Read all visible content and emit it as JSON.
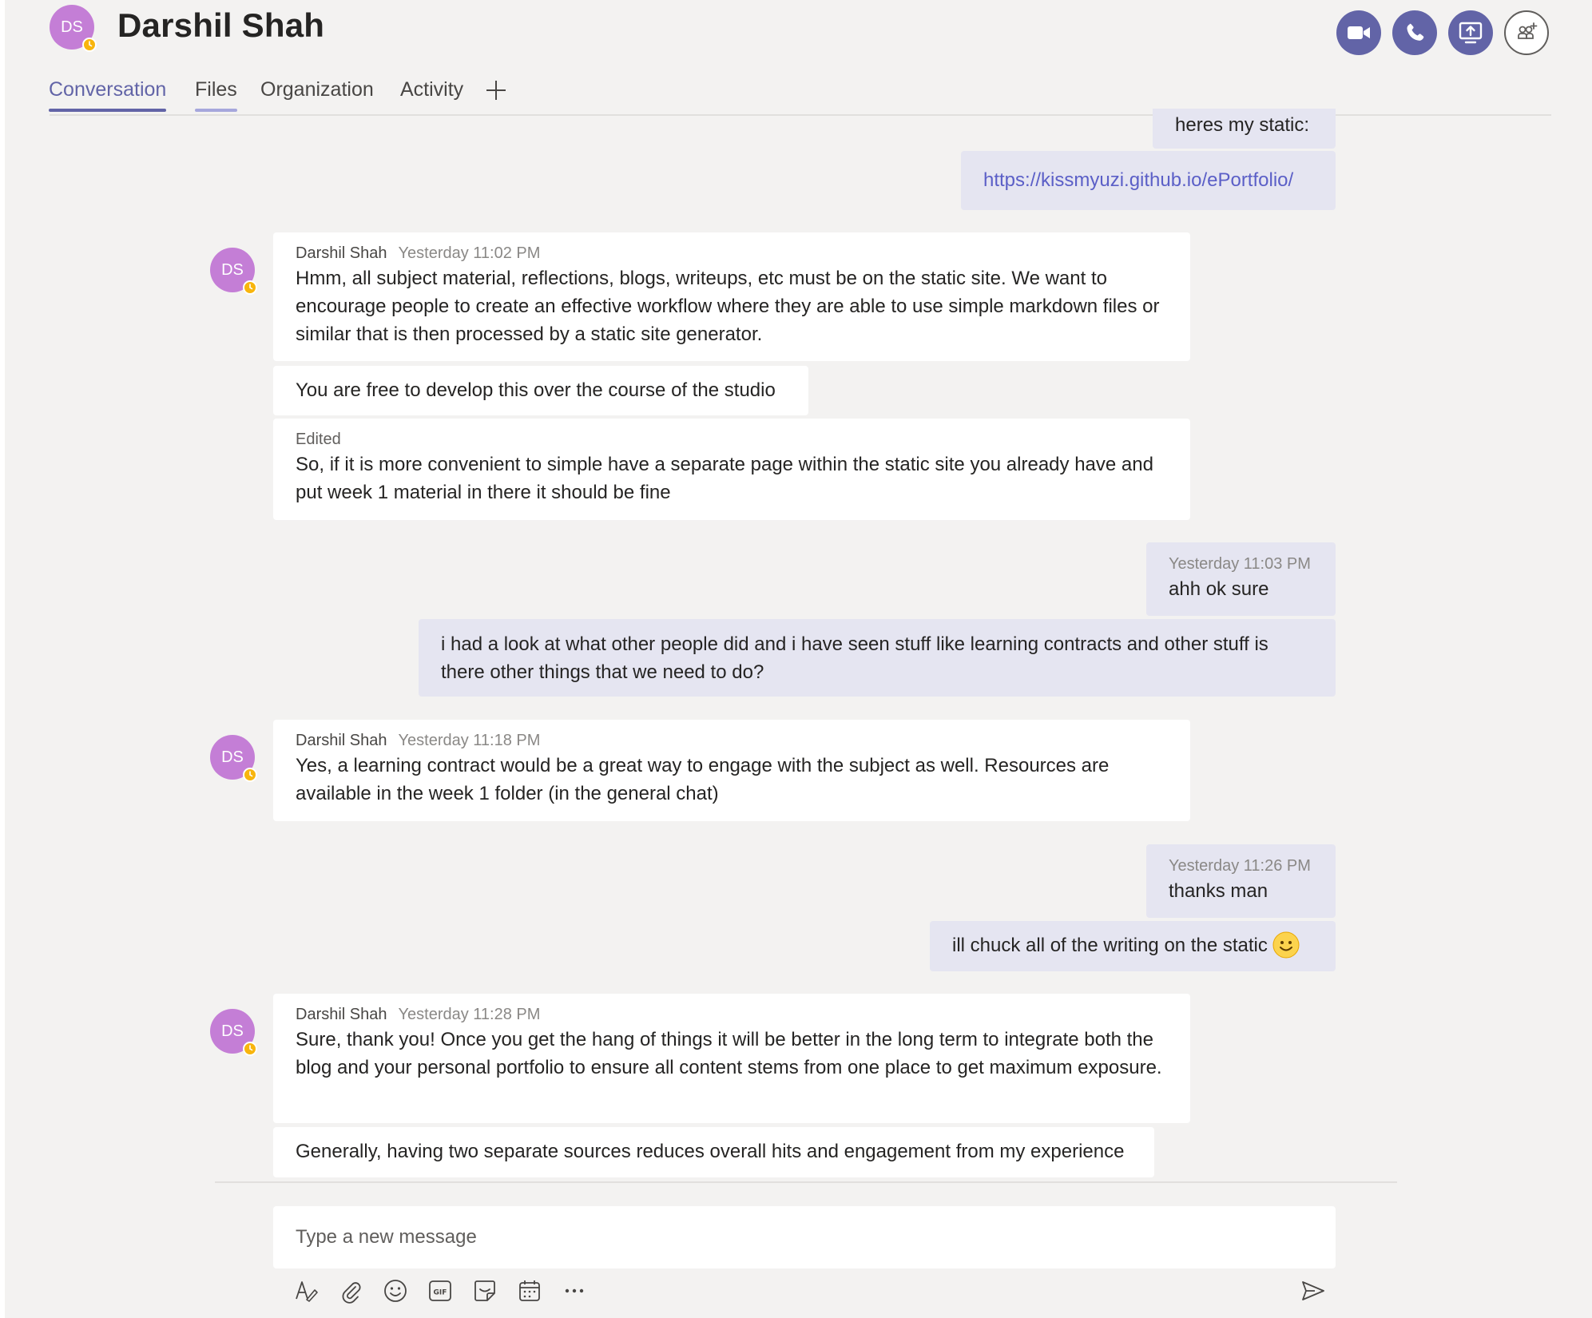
{
  "header": {
    "avatar_initials": "DS",
    "title": "Darshil Shah",
    "buttons": [
      "video-call-icon",
      "audio-call-icon",
      "share-screen-icon",
      "add-people-icon"
    ]
  },
  "tabs": [
    {
      "label": "Conversation"
    },
    {
      "label": "Files"
    },
    {
      "label": "Organization"
    },
    {
      "label": "Activity"
    }
  ],
  "messages": {
    "m0": {
      "text": "heres my static:"
    },
    "m1": {
      "link": "https://kissmyuzi.github.io/ePortfolio/"
    },
    "m2": {
      "avatar": "DS",
      "sender": "Darshil Shah",
      "time": "Yesterday 11:02 PM",
      "text": "Hmm, all subject material, reflections, blogs, writeups, etc must be on the static site. We want to encourage people to create an effective workflow where they are able to use simple markdown files or similar that is then processed by a static site generator."
    },
    "m3": {
      "text": "You are free to develop this over the course of the studio"
    },
    "m4": {
      "edited": "Edited",
      "text": "So, if it is more convenient to simple have a separate page within the static site you already have and put week 1 material in there it should be fine"
    },
    "m5": {
      "time": "Yesterday 11:03 PM",
      "text": "ahh ok sure"
    },
    "m6": {
      "text": "i had a look at what other people did and i have seen stuff like learning contracts and other stuff is there other things that we need to do?"
    },
    "m7": {
      "avatar": "DS",
      "sender": "Darshil Shah",
      "time": "Yesterday 11:18 PM",
      "text": "Yes, a learning contract would be a great way to engage with the subject as well. Resources are available in the week 1 folder (in the general chat)"
    },
    "m8": {
      "time": "Yesterday 11:26 PM",
      "text": "thanks man"
    },
    "m9": {
      "text": "ill chuck all of the writing on the static",
      "emoji": "smile-emoji-icon"
    },
    "m10": {
      "avatar": "DS",
      "sender": "Darshil Shah",
      "time": "Yesterday 11:28 PM",
      "text": "Sure, thank you! Once you get the hang of things it will be better in the long term to integrate both the blog and your personal portfolio to ensure all content stems from one place to get maximum exposure."
    },
    "m11": {
      "text": "Generally, having two separate sources reduces overall hits and engagement from my experience"
    }
  },
  "compose": {
    "placeholder": "Type a new message",
    "tools": [
      "format-icon",
      "attach-icon",
      "emoji-icon",
      "gif-icon",
      "sticker-icon",
      "schedule-meeting-icon",
      "more-options-icon",
      "send-icon"
    ]
  },
  "colors": {
    "accent": "#6264a7",
    "avatar": "#c47ed6",
    "presence_away": "#f8b50d",
    "incoming_bubble": "#ffffff",
    "outgoing_bubble": "#e5e5f1",
    "background": "#f3f2f1"
  }
}
